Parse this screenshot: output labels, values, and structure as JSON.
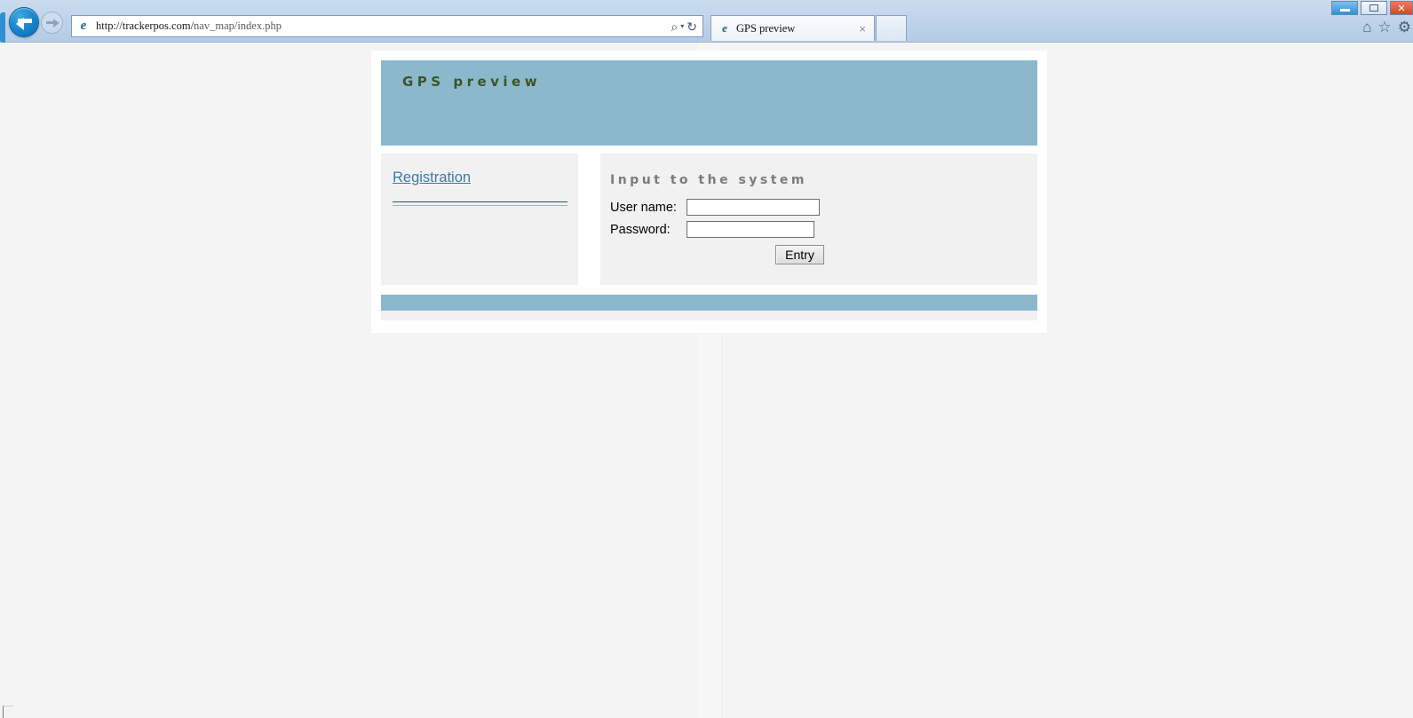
{
  "browser": {
    "back_icon": "back-arrow-icon",
    "forward_icon": "forward-arrow-icon",
    "favicon": "internet-explorer-icon",
    "url": "http://trackerpos.com/",
    "url_path": "nav_map/index.php",
    "search_icon": "search-magnifier-icon",
    "search_caret": "▾",
    "refresh_icon": "↻",
    "tab": {
      "icon": "internet-explorer-icon",
      "title": "GPS preview",
      "close": "×"
    },
    "new_tab_label": "",
    "window_controls": {
      "minimize": "minimize-icon",
      "maximize": "maximize-icon",
      "close": "✕"
    },
    "toolbar_icons": {
      "home": "⌂",
      "favorites": "☆",
      "settings": "⚙"
    }
  },
  "page": {
    "site_title": "GPS preview",
    "sidebar": {
      "registration_label": "Registration"
    },
    "login": {
      "heading": "Input to the system",
      "username_label": "User name:",
      "username_value": "",
      "username_placeholder": "",
      "password_label": "Password:",
      "password_value": "",
      "password_placeholder": "",
      "submit_label": "Entry"
    }
  },
  "colors": {
    "header_blue": "#8cb8ce",
    "title_olive": "#3d5423",
    "link_blue": "#3a7ba5",
    "heading_gray": "#7b7b7b",
    "panel_gray": "#f1f1f1"
  }
}
